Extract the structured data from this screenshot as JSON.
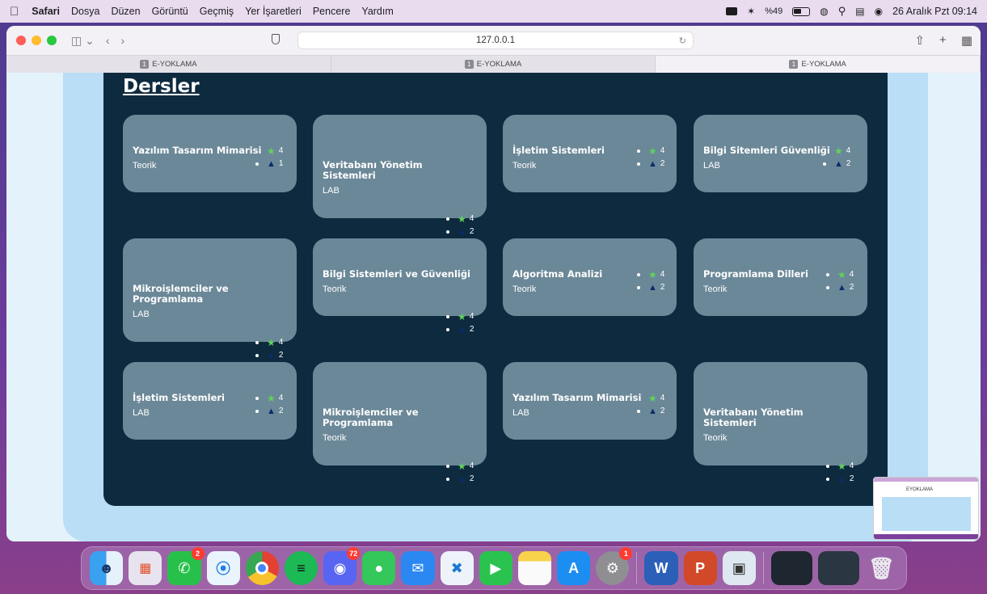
{
  "menubar": {
    "apple": "",
    "items": [
      "Safari",
      "Dosya",
      "Düzen",
      "Görüntü",
      "Geçmiş",
      "Yer İşaretleri",
      "Pencere",
      "Yardım"
    ],
    "battery_text": "%49",
    "datetime": "26 Aralık Pzt 09:14"
  },
  "browser": {
    "url": "127.0.0.1",
    "tabs": [
      {
        "label": "E-YOKLAMA",
        "favicon": "1"
      },
      {
        "label": "E-YOKLAMA",
        "favicon": "1"
      },
      {
        "label": "E-YOKLAMA",
        "favicon": "1"
      }
    ]
  },
  "page": {
    "title": "Dersler",
    "courses": [
      {
        "name": "Yazılım Tasarım Mimarisi",
        "type": "Teorik",
        "stars": "4",
        "warnings": "1"
      },
      {
        "name": "Veritabanı Yönetim Sistemleri",
        "type": "LAB",
        "stars": "4",
        "warnings": "2"
      },
      {
        "name": "İşletim Sistemleri",
        "type": "Teorik",
        "stars": "4",
        "warnings": "2"
      },
      {
        "name": "Bilgi Sitemleri Güvenliği",
        "type": "LAB",
        "stars": "4",
        "warnings": "2"
      },
      {
        "name": "Mikroişlemciler ve Programlama",
        "type": "LAB",
        "stars": "4",
        "warnings": "2"
      },
      {
        "name": "Bilgi Sistemleri ve Güvenliği",
        "type": "Teorik",
        "stars": "4",
        "warnings": "2"
      },
      {
        "name": "Algoritma Analizi",
        "type": "Teorik",
        "stars": "4",
        "warnings": "2"
      },
      {
        "name": "Programlama Dilleri",
        "type": "Teorik",
        "stars": "4",
        "warnings": "2"
      },
      {
        "name": "İşletim Sistemleri",
        "type": "LAB",
        "stars": "4",
        "warnings": "2"
      },
      {
        "name": "Mikroişlemciler ve Programlama",
        "type": "Teorik",
        "stars": "4",
        "warnings": "2"
      },
      {
        "name": "Yazılım Tasarım Mimarisi",
        "type": "LAB",
        "stars": "4",
        "warnings": "2"
      },
      {
        "name": "Veritabanı Yönetim Sistemleri",
        "type": "Teorik",
        "stars": "4",
        "warnings": "2"
      }
    ]
  },
  "thumbnail": {
    "label": "EYOKLAMA"
  },
  "dock": {
    "whatsapp_badge": "2",
    "discord_badge": "72",
    "settings_badge": "1"
  },
  "colors": {
    "panel": "#0e2a3f",
    "card": "#6b8898",
    "star": "#5fd35a",
    "warning": "#0b2a6a"
  }
}
